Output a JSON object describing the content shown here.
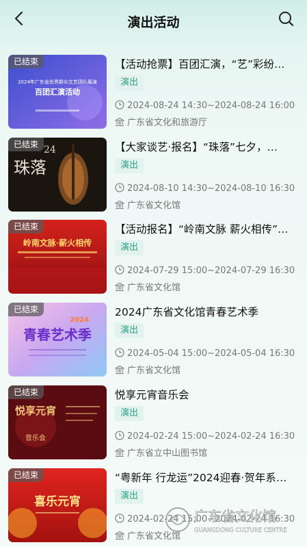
{
  "header": {
    "title": "演出活动"
  },
  "events": [
    {
      "status": "已结束",
      "title": "【活动抢票】百团汇演，“艺”彩纷…",
      "tag": "演出",
      "time": "2024-08-24 14:30~2024-08-24 16:00",
      "venue": "广东省文化和旅游厅",
      "poster": {
        "heading": "2024年广东省优秀群众文艺团队展演",
        "main": "百团汇演活动"
      }
    },
    {
      "status": "已结束",
      "title": "【大家谈艺·报名】“珠落”七夕，…",
      "tag": "演出",
      "time": "2024-08-10 14:30~2024-08-10 16:30",
      "venue": "广东省文化馆",
      "poster": {
        "main": "珠落",
        "year": "24"
      }
    },
    {
      "status": "已结束",
      "title": "【活动报名】“岭南文脉 薪火相传”…",
      "tag": "演出",
      "time": "2024-07-29 15:00~2024-07-29 16:30",
      "venue": "广东省文化馆",
      "poster": {
        "main": "岭南文脉·薪火相传"
      }
    },
    {
      "status": "已结束",
      "title": "2024广东省文化馆青春艺术季",
      "tag": "演出",
      "time": "2024-05-04 15:00~2024-05-04 16:30",
      "venue": "广东省文化馆",
      "poster": {
        "main": "青春艺术季",
        "year": "2024"
      }
    },
    {
      "status": "已结束",
      "title": "悦享元宵音乐会",
      "tag": "演出",
      "time": "2024-02-24 15:00~2024-02-24 16:30",
      "venue": "广东省立中山图书馆",
      "poster": {
        "main": "悦享元宵",
        "sub": "音乐会"
      }
    },
    {
      "status": "已结束",
      "title": "“粤新年 行龙运”2024迎春·贺年系…",
      "tag": "演出",
      "time": "2024-02-24 15:00~2024-02-24 16:30",
      "venue": "广东省文化馆",
      "poster": {
        "main": "喜乐元宵"
      }
    }
  ],
  "watermark": {
    "name": "广东省文化馆",
    "english": "GUANGDONG CULTURE CENTRE"
  },
  "colors": {
    "accent": "#2f9f86",
    "tag_bg": "#e2f3ee"
  }
}
